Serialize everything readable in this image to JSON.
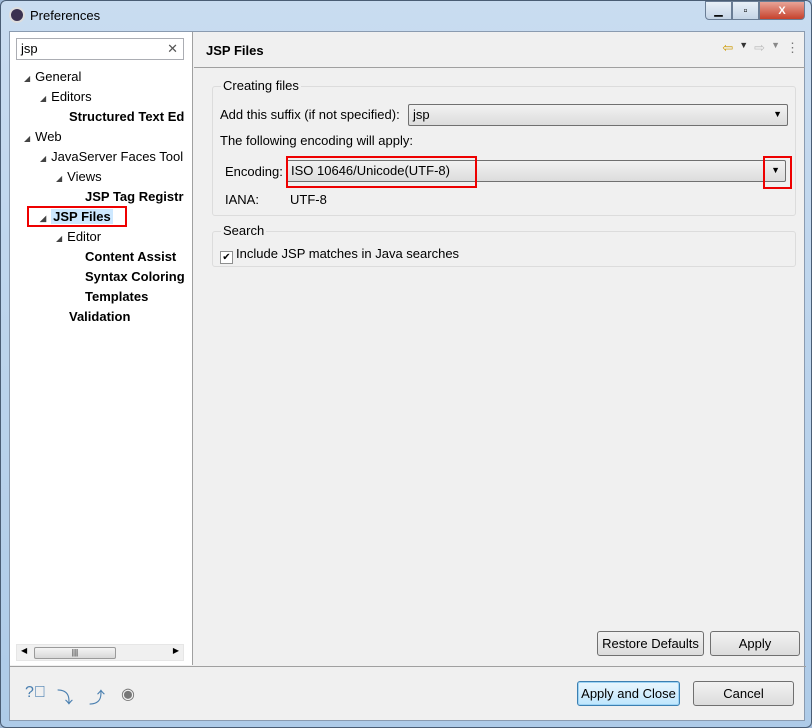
{
  "window": {
    "title": "Preferences"
  },
  "search": {
    "value": "jsp"
  },
  "tree": [
    {
      "label": "General",
      "bold": false,
      "expanded": true
    },
    {
      "label": "Editors",
      "bold": false,
      "expanded": true
    },
    {
      "label": "Structured Text Ed",
      "bold": true
    },
    {
      "label": "Web",
      "bold": false,
      "expanded": true
    },
    {
      "label": "JavaServer Faces Tool",
      "bold": false,
      "expanded": true
    },
    {
      "label": "Views",
      "bold": false,
      "expanded": true
    },
    {
      "label": "JSP Tag Registr",
      "bold": true
    },
    {
      "label": "JSP Files",
      "bold": true,
      "selected": true
    },
    {
      "label": "Editor",
      "bold": false,
      "expanded": true
    },
    {
      "label": "Content Assist",
      "bold": true
    },
    {
      "label": "Syntax Coloring",
      "bold": true
    },
    {
      "label": "Templates",
      "bold": true
    },
    {
      "label": "Validation",
      "bold": true
    }
  ],
  "page": {
    "title": "JSP Files",
    "creating": {
      "label": "Creating files",
      "suffix_label": "Add this suffix (if not specified):",
      "suffix_value": "jsp",
      "encoding_note": "The following encoding will apply:",
      "encoding_label": "Encoding:",
      "encoding_value": "ISO 10646/Unicode(UTF-8)",
      "iana_label": "IANA:",
      "iana_value": "UTF-8"
    },
    "search": {
      "label": "Search",
      "checkbox_label": "Include JSP matches in Java searches",
      "checked": true
    },
    "restore_defaults": "Restore Defaults",
    "apply": "Apply"
  },
  "footer": {
    "apply_close": "Apply and Close",
    "cancel": "Cancel"
  },
  "highlight_color": "#e00000"
}
